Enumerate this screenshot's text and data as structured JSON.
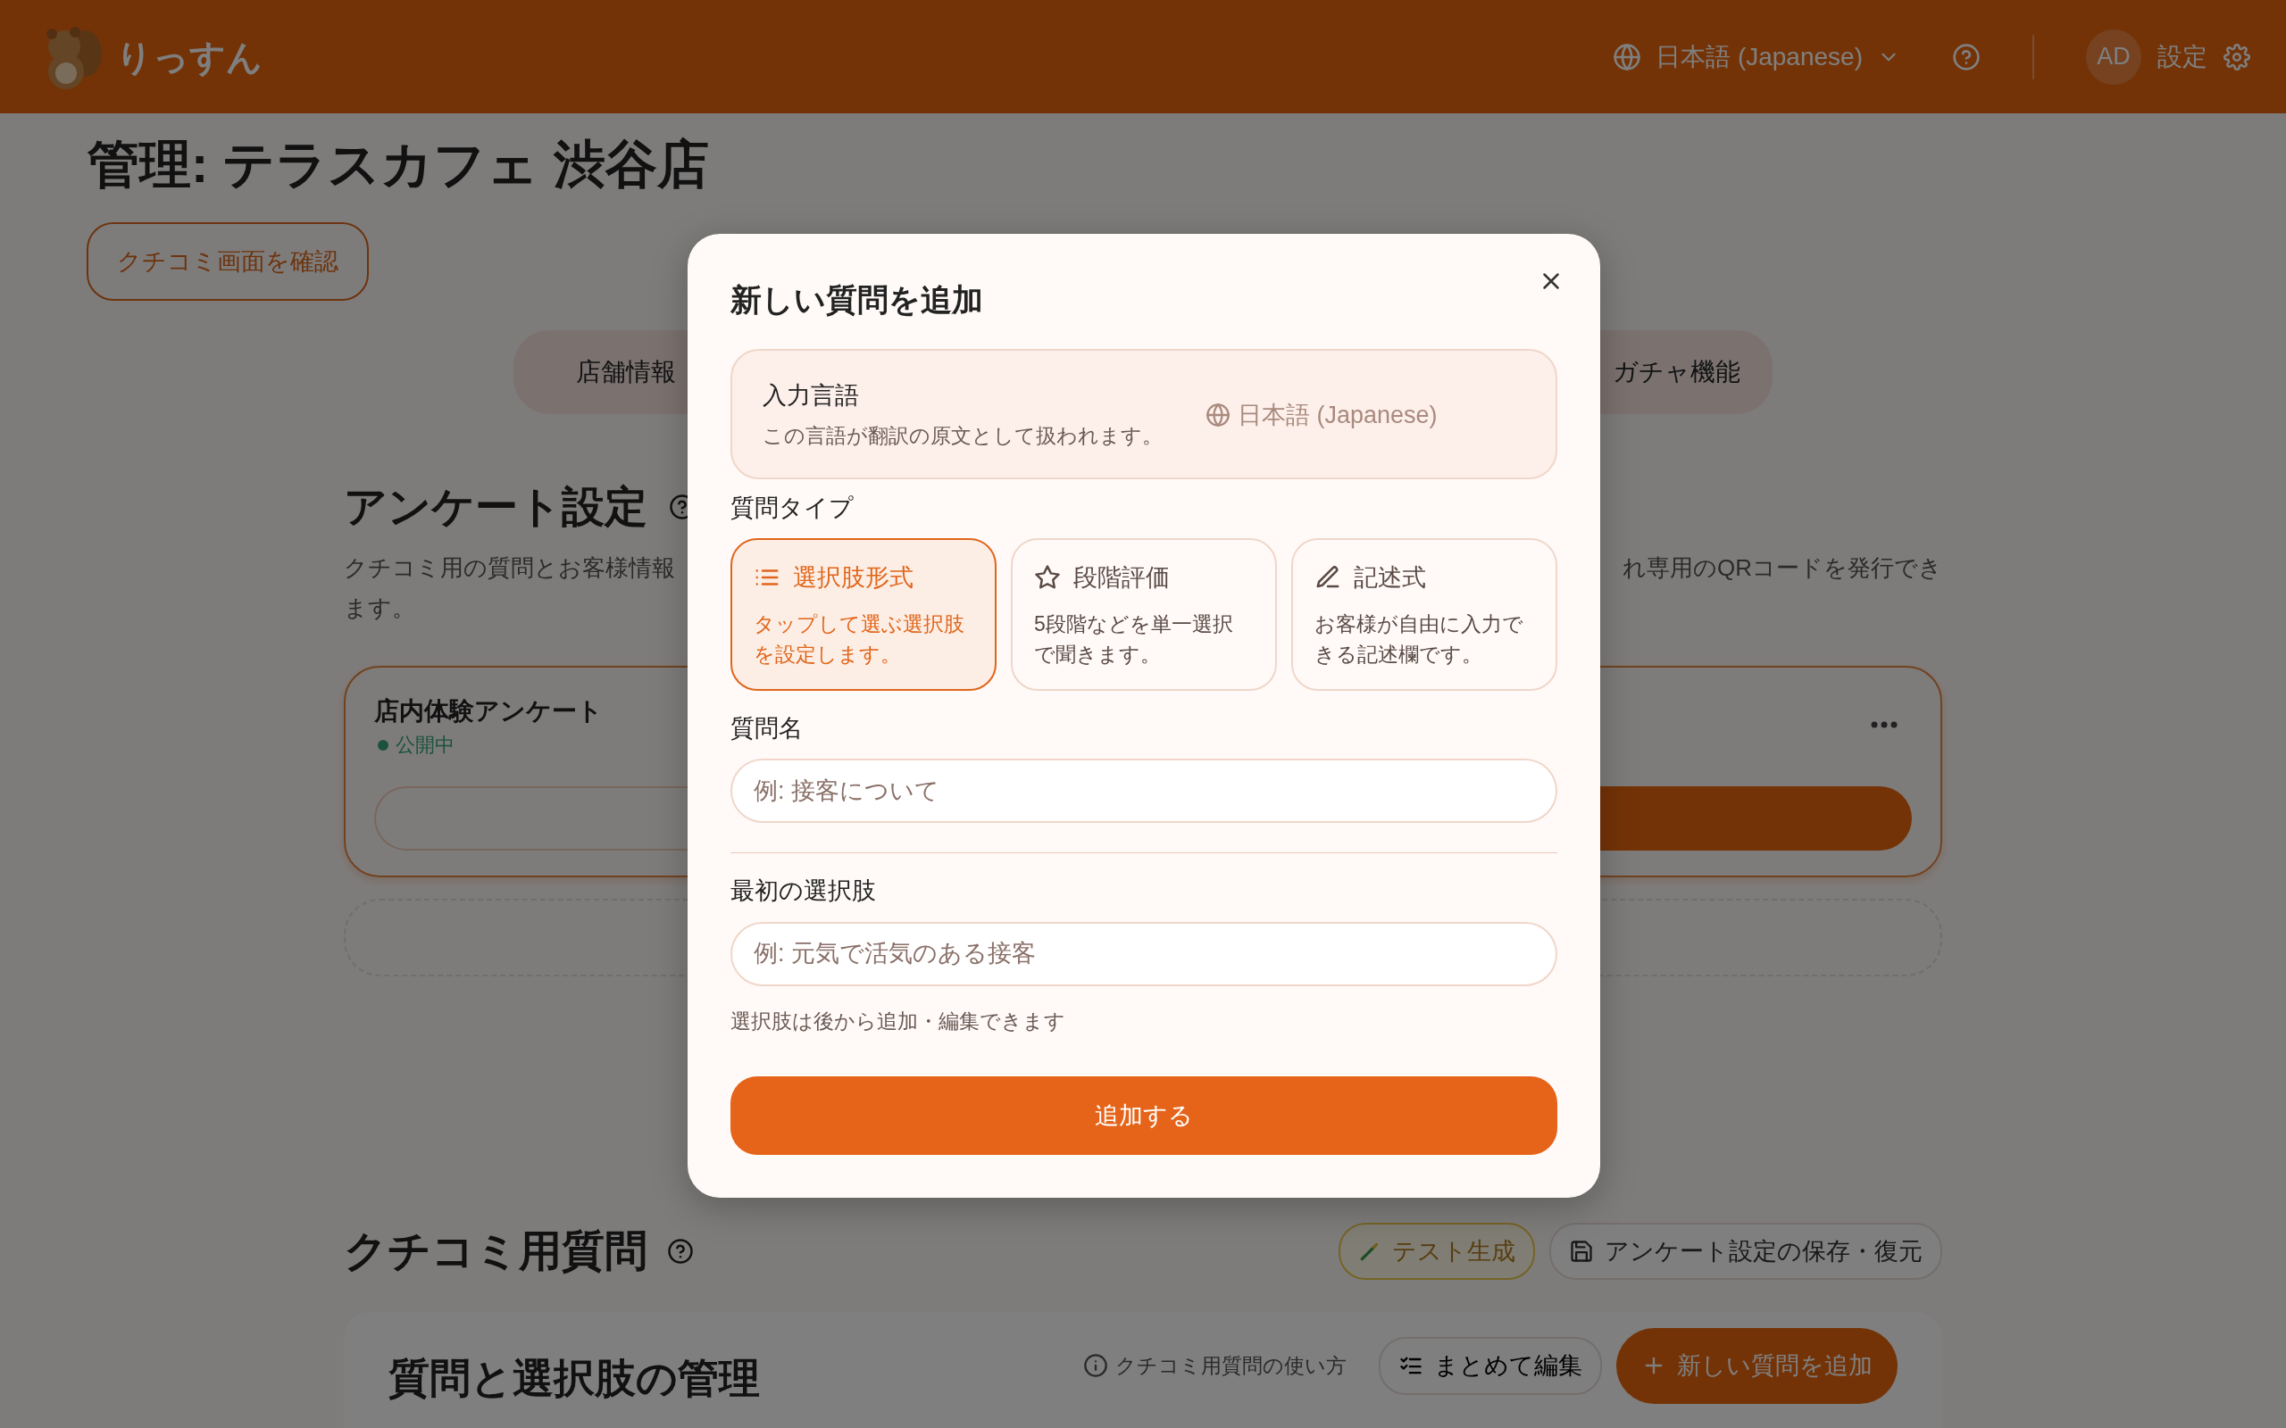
{
  "header": {
    "logo_text": "りっすん",
    "language": "日本語 (Japanese)",
    "avatar": "AD",
    "settings_label": "設定"
  },
  "page": {
    "title": "管理: テラスカフェ 渋谷店",
    "preview_button": "クチコミ画面を確認"
  },
  "tabs": [
    {
      "label": "店舗情報"
    },
    {
      "label": "ガチャ機能"
    }
  ],
  "survey_section": {
    "title": "アンケート設定",
    "description_left": "クチコミ用の質問とお客様情報",
    "description_right": "れ専用のQRコードを発行でき",
    "description_end": "ます。",
    "surveys": [
      {
        "name": "店内体験アンケート",
        "status": "公開中"
      }
    ]
  },
  "review_section": {
    "title": "クチコミ用質問",
    "buttons": [
      {
        "label": "テスト生成",
        "kind": "test"
      },
      {
        "label": "アンケート設定の保存・復元",
        "kind": "save"
      }
    ],
    "panel": {
      "title": "質問と選択肢の管理",
      "help_link": "クチコミ用質問の使い方",
      "bulk_edit": "まとめて編集",
      "add_button": "新しい質問を追加"
    }
  },
  "modal": {
    "title": "新しい質問を追加",
    "language_box": {
      "label": "入力言語",
      "hint": "この言語が翻訳の原文として扱われます。",
      "value": "日本語 (Japanese)"
    },
    "type_label": "質問タイプ",
    "types": [
      {
        "kind": "choice",
        "label": "選択肢形式",
        "description": "タップして選ぶ選択肢を設定します。",
        "selected": true
      },
      {
        "kind": "rating",
        "label": "段階評価",
        "description": "5段階などを単一選択で聞きます。",
        "selected": false
      },
      {
        "kind": "text",
        "label": "記述式",
        "description": "お客様が自由に入力できる記述欄です。",
        "selected": false
      }
    ],
    "fields": [
      {
        "label": "質問名",
        "placeholder": "例: 接客について"
      },
      {
        "label": "最初の選択肢",
        "placeholder": "例: 元気で活気のある接客"
      }
    ],
    "hint": "選択肢は後から追加・編集できます",
    "submit": "追加する"
  }
}
